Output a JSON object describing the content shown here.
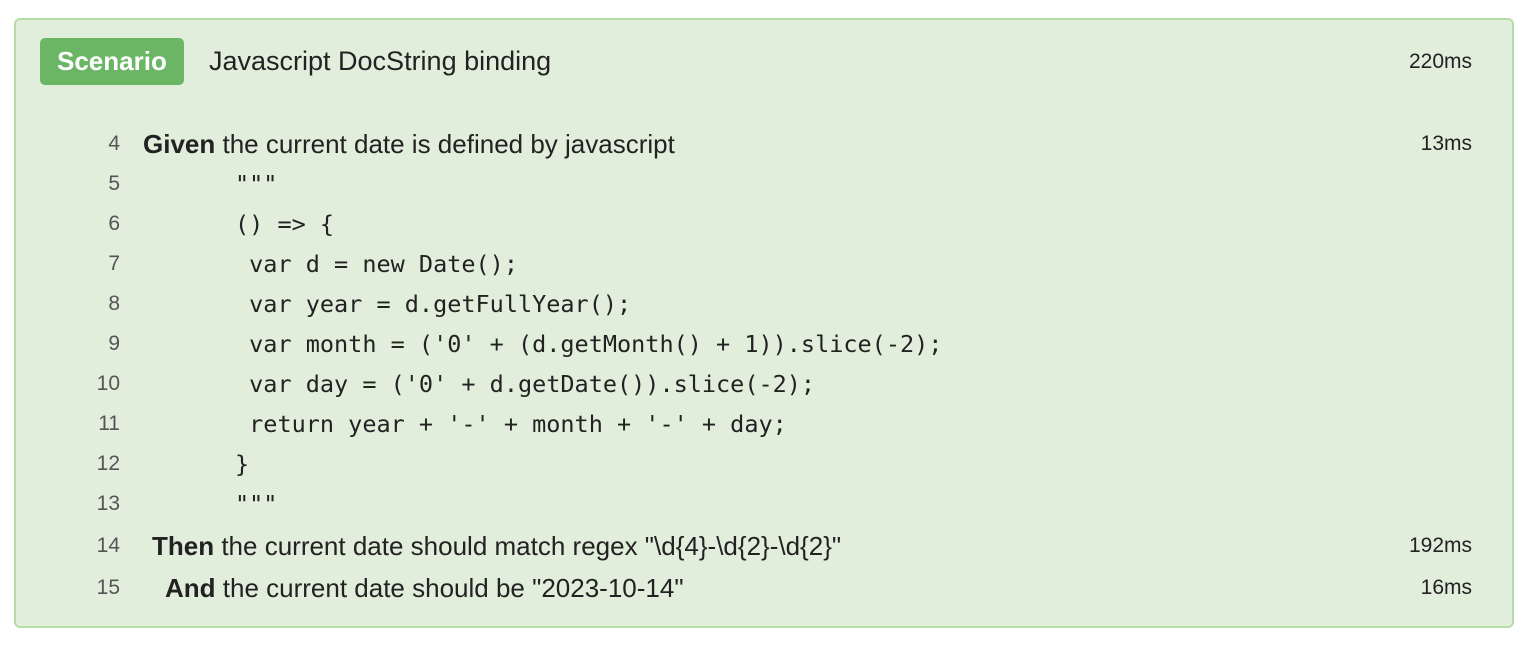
{
  "scenario": {
    "badge": "Scenario",
    "title": "Javascript DocString binding",
    "duration": "220ms"
  },
  "steps": [
    {
      "line": "4",
      "keyword": "Given",
      "text": " the current date is defined by javascript",
      "duration": "13ms"
    },
    {
      "line": "14",
      "keyword": "Then",
      "text": " the current date should match regex \"\\d{4}-\\d{2}-\\d{2}\"",
      "duration": "192ms"
    },
    {
      "line": "15",
      "keyword": "And",
      "text": " the current date should be \"2023-10-14\"",
      "duration": "16ms"
    }
  ],
  "docstring": [
    {
      "line": "5",
      "text": "\"\"\""
    },
    {
      "line": "6",
      "text": "() => {"
    },
    {
      "line": "7",
      "text": " var d = new Date();"
    },
    {
      "line": "8",
      "text": " var year = d.getFullYear();"
    },
    {
      "line": "9",
      "text": " var month = ('0' + (d.getMonth() + 1)).slice(-2);"
    },
    {
      "line": "10",
      "text": " var day = ('0' + d.getDate()).slice(-2);"
    },
    {
      "line": "11",
      "text": " return year + '-' + month + '-' + day;"
    },
    {
      "line": "12",
      "text": "}"
    },
    {
      "line": "13",
      "text": "\"\"\""
    }
  ],
  "colors": {
    "panel_background": "#e1eedb",
    "panel_border": "#b6dca9",
    "badge_background": "#6bb665",
    "badge_text": "#ffffff"
  }
}
